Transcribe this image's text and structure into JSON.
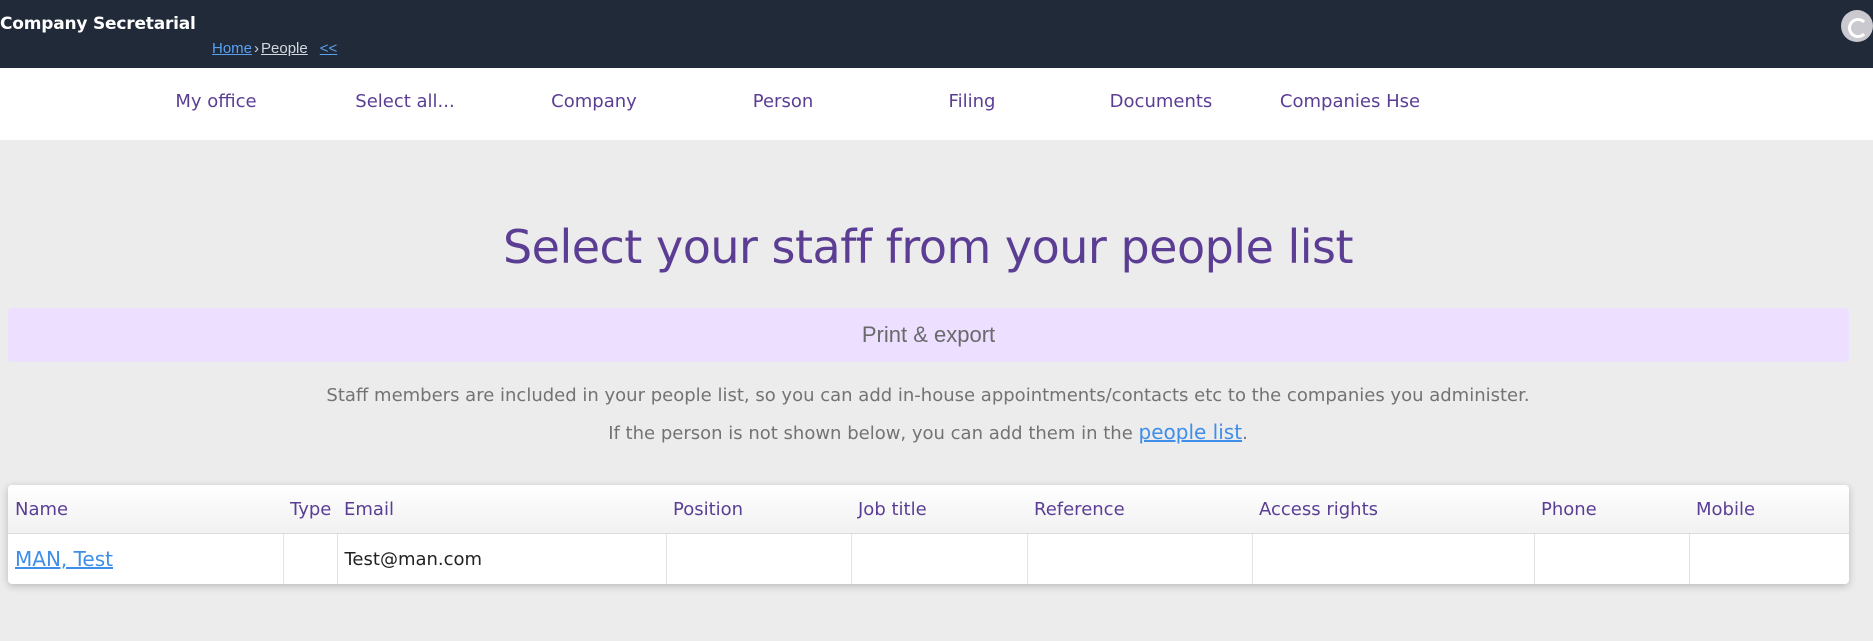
{
  "header": {
    "app_title": "Company Secretarial",
    "breadcrumb": {
      "home": "Home",
      "separator": "›",
      "current": "People",
      "collapse": "<<"
    },
    "avatar_icon": "user-avatar-icon"
  },
  "nav": {
    "items": [
      {
        "label": "My office"
      },
      {
        "label": "Select all..."
      },
      {
        "label": "Company"
      },
      {
        "label": "Person"
      },
      {
        "label": "Filing"
      },
      {
        "label": "Documents"
      },
      {
        "label": "Companies Hse"
      }
    ]
  },
  "main": {
    "title": "Select your staff from your people list",
    "print_export_label": "Print & export",
    "info_line1": "Staff members are included in your people list, so you can add in-house appointments/contacts etc to the companies you administer.",
    "info_line2_prefix": "If the person is not shown below, you can add them in the",
    "info_line2_link": "people list",
    "info_line2_suffix": "."
  },
  "table": {
    "columns": [
      "Name",
      "Type",
      "Email",
      "Position",
      "Job title",
      "Reference",
      "Access rights",
      "Phone",
      "Mobile"
    ],
    "rows": [
      {
        "name": "MAN, Test",
        "type": "",
        "email": "Test@man.com",
        "position": "",
        "job_title": "",
        "reference": "",
        "access_rights": "",
        "phone": "",
        "mobile": ""
      }
    ]
  },
  "colors": {
    "topbar": "#212a39",
    "accent_purple": "#5b3e94",
    "print_bar": "#ecdfff",
    "link_blue": "#3f8ee8",
    "page_bg": "#ececec"
  }
}
